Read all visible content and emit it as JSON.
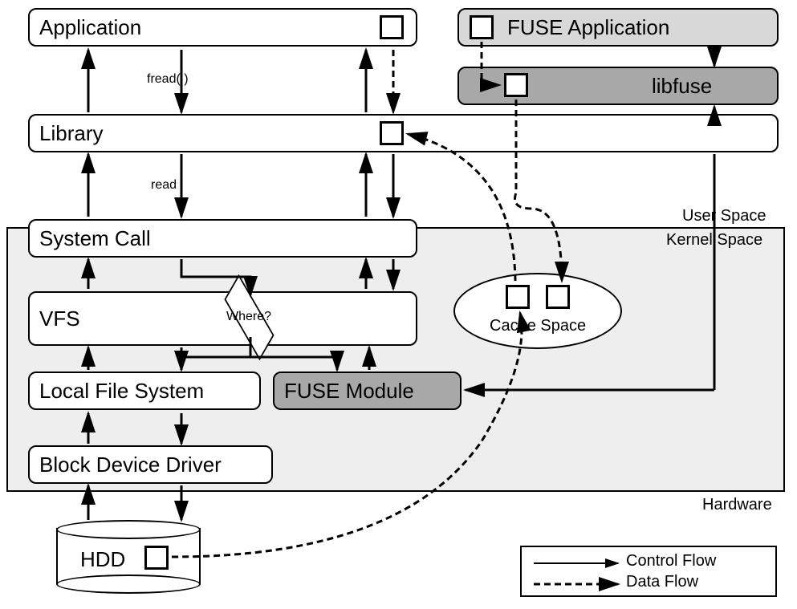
{
  "boxes": {
    "application": "Application",
    "fuse_app": "FUSE Application",
    "libfuse": "libfuse",
    "library": "Library",
    "system_call": "System Call",
    "vfs": "VFS",
    "local_fs": "Local File System",
    "fuse_module": "FUSE Module",
    "block_driver": "Block Device Driver",
    "hdd": "HDD"
  },
  "labels": {
    "fread": "fread( )",
    "read": "read",
    "where": "Where?",
    "cache_space": "Cache Space",
    "user_space": "User Space",
    "kernel_space": "Kernel Space",
    "hardware": "Hardware"
  },
  "legend": {
    "control_flow": "Control Flow",
    "data_flow": "Data Flow"
  }
}
